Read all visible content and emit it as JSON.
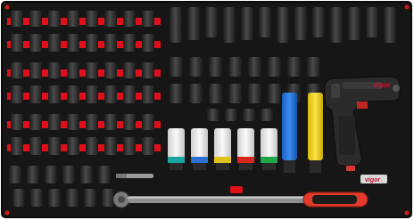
{
  "scene": {
    "brand_logo_text": "vigor",
    "colors": {
      "background": "#ffffff",
      "tray_foam": "#161616",
      "tray_border": "#0b0b0b",
      "accent_red": "#e0101a",
      "socket_steel": "#3a3a3a",
      "extension_blue": "#1f6fd4",
      "extension_yellow": "#f1d21a",
      "impact_sleeve_white": "#e9e9e9",
      "sleeve_band_colors": [
        "#1aa6a0",
        "#2f6fd8",
        "#e0c21a",
        "#d8261a",
        "#1fa84a"
      ],
      "handle_red": "#e33a2a"
    },
    "items": [
      "socket-rack-rows",
      "deep-impact-sockets",
      "colored-extension-bars",
      "impact-protection-sleeves",
      "impact-wrench",
      "torque-wrench",
      "bit-holder"
    ]
  }
}
